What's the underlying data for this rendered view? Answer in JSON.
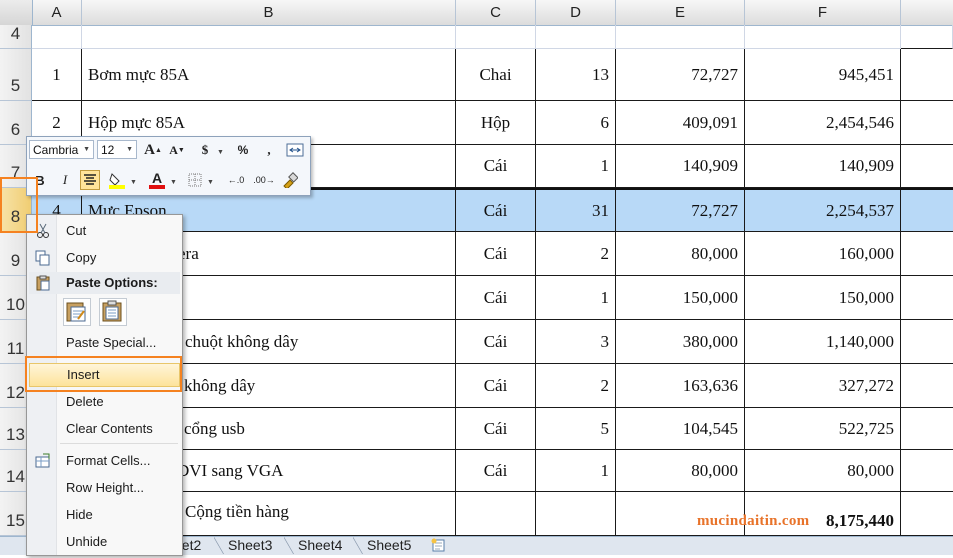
{
  "columns": [
    "A",
    "B",
    "C",
    "D",
    "E",
    "F"
  ],
  "rows": [
    {
      "num": "4",
      "a": "",
      "b": "",
      "c": "",
      "d": "",
      "e": "",
      "f": ""
    },
    {
      "num": "5",
      "a": "1",
      "b": "Bơm mực 85A",
      "c": "Chai",
      "d": "13",
      "e": "72,727",
      "f": "945,451"
    },
    {
      "num": "6",
      "a": "2",
      "b": "Hộp mực 85A",
      "c": "Hộp",
      "d": "6",
      "e": "409,091",
      "f": "2,454,546"
    },
    {
      "num": "7",
      "a": "",
      "b": "",
      "c": "Cái",
      "d": "1",
      "e": "140,909",
      "f": "140,909"
    },
    {
      "num": "8",
      "a": "4",
      "b": "Mực Epson",
      "c": "Cái",
      "d": "31",
      "e": "72,727",
      "f": "2,254,537"
    },
    {
      "num": "9",
      "a": "",
      "b": "era",
      "c": "Cái",
      "d": "2",
      "e": "80,000",
      "f": "160,000"
    },
    {
      "num": "10",
      "a": "",
      "b": "",
      "c": "Cái",
      "d": "1",
      "e": "150,000",
      "f": "150,000"
    },
    {
      "num": "11",
      "a": "",
      "b": "chuột không dây",
      "c": "Cái",
      "d": "3",
      "e": "380,000",
      "f": "1,140,000"
    },
    {
      "num": "12",
      "a": "",
      "b": "không dây",
      "c": "Cái",
      "d": "2",
      "e": "163,636",
      "f": "327,272"
    },
    {
      "num": "13",
      "a": "",
      "b": "cổng usb",
      "c": "Cái",
      "d": "5",
      "e": "104,545",
      "f": "522,725"
    },
    {
      "num": "14",
      "a": "",
      "b": "DVI sang VGA",
      "c": "Cái",
      "d": "1",
      "e": "80,000",
      "f": "80,000"
    },
    {
      "num": "15",
      "a": "",
      "b": "Cộng tiền hàng",
      "c": "",
      "d": "",
      "e": "",
      "f": "8,175,440"
    }
  ],
  "mini_toolbar": {
    "font_name": "Cambria",
    "font_size": "12",
    "grow_font": "A",
    "shrink_font": "A",
    "currency": "$",
    "percent": "%",
    "comma": ",",
    "bold": "B",
    "italic": "I",
    "font_color_glyph": "A",
    "increase_decimal": "←.0",
    "decrease_decimal": ".00→"
  },
  "context_menu": {
    "cut": "Cut",
    "copy": "Copy",
    "paste_options": "Paste Options:",
    "paste_special": "Paste Special...",
    "insert": "Insert",
    "delete": "Delete",
    "clear_contents": "Clear Contents",
    "format_cells": "Format Cells...",
    "row_height": "Row Height...",
    "hide": "Hide",
    "unhide": "Unhide"
  },
  "sheet_tabs": [
    "eet2",
    "Sheet3",
    "Sheet4",
    "Sheet5"
  ],
  "watermark": "mucindaitin.com",
  "colors": {
    "selected_row": "#b8d9f7",
    "highlight_box": "#f58220",
    "font_color": "#e01010",
    "fill_color": "#ffff00"
  }
}
